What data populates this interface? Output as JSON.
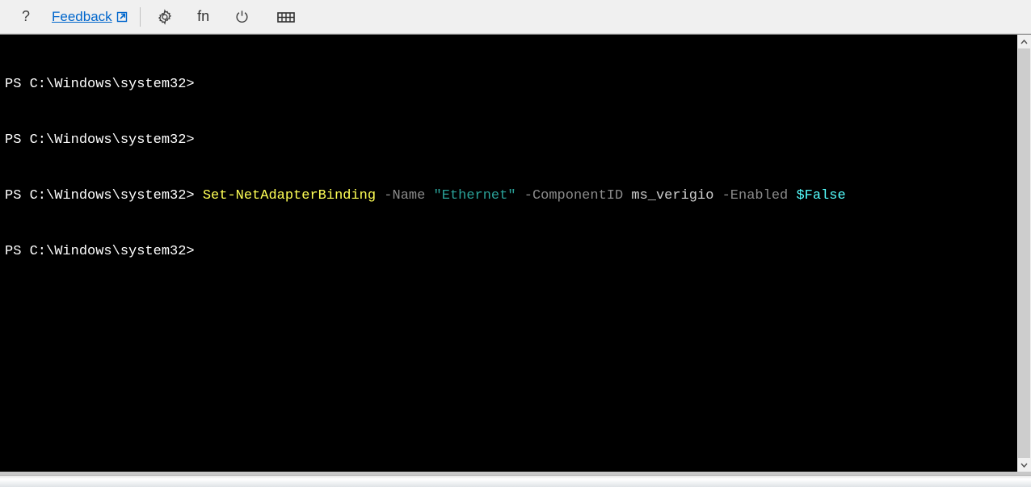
{
  "toolbar": {
    "help_label": "?",
    "feedback_label": "Feedback",
    "fn_label": "fn"
  },
  "terminal": {
    "prompt": "PS C:\\Windows\\system32>",
    "cmd": {
      "cmdlet": "Set-NetAdapterBinding",
      "param_name": "-Name",
      "arg_name": "\"Ethernet\"",
      "param_componentid": "-ComponentID",
      "arg_componentid": "ms_verigio",
      "param_enabled": "-Enabled",
      "arg_enabled": "$False"
    }
  }
}
